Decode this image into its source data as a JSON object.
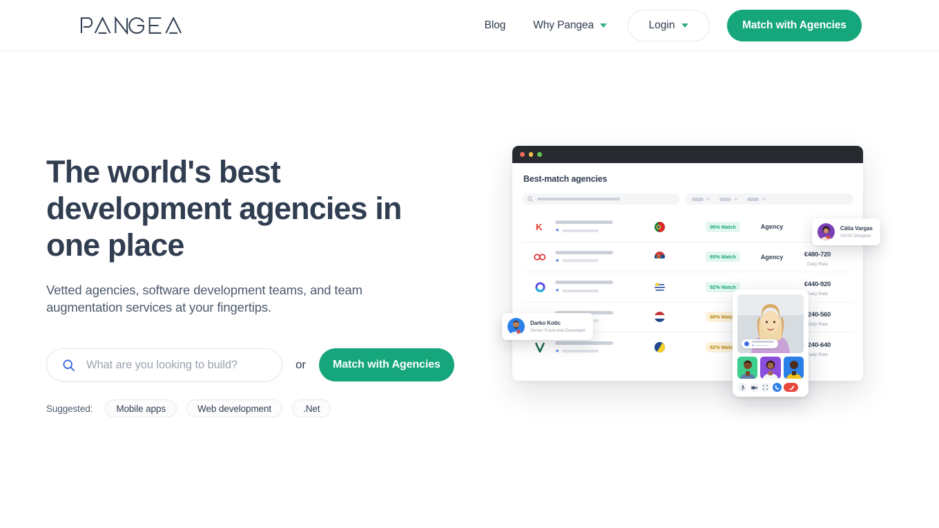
{
  "brand": {
    "name": "PANGEA",
    "accent": "#16a67c",
    "text_color": "#313e51"
  },
  "header": {
    "nav": [
      {
        "label": "Blog",
        "has_caret": false
      },
      {
        "label": "Why Pangea",
        "has_caret": true
      }
    ],
    "login_label": "Login",
    "cta_label": "Match with Agencies"
  },
  "hero": {
    "headline": "The world's best development agencies in one place",
    "subhead": "Vetted agencies, software development teams, and team augmentation services at your fingertips.",
    "search_placeholder": "What are you looking to build?",
    "search_value": "",
    "search_icon": "search-icon",
    "or_label": "or",
    "cta_label": "Match with Agencies",
    "suggested_label": "Suggested:",
    "suggested": [
      "Mobile apps",
      "Web development",
      ".Net"
    ]
  },
  "mock": {
    "title": "Best-match agencies",
    "window_dots": [
      "red",
      "yellow",
      "green"
    ],
    "rows": [
      {
        "logo": "kaizen-k-logo",
        "flag": "portugal-flag",
        "match": "95% Match",
        "match_tone": "green",
        "type": "Agency",
        "rate": "",
        "rate_label": ""
      },
      {
        "logo": "infinity-logo",
        "flag": "serbia-flag",
        "match": "93% Match",
        "match_tone": "green",
        "type": "Agency",
        "rate": "€480-720",
        "rate_label": "Daily Rate"
      },
      {
        "logo": "ring-o-logo",
        "flag": "uruguay-flag",
        "match": "92% Match",
        "match_tone": "green",
        "type": "",
        "rate": "€440-920",
        "rate_label": "Daily Rate"
      },
      {
        "logo": "hidden-logo",
        "flag": "netherlands-flag",
        "match": "88% Match",
        "match_tone": "amber",
        "type": "",
        "rate": "€240-560",
        "rate_label": "Daily Rate"
      },
      {
        "logo": "v-logo",
        "flag": "bosnia-flag",
        "match": "82% Match",
        "match_tone": "amber",
        "type": "",
        "rate": "€240-640",
        "rate_label": "Daily Rate"
      }
    ],
    "cards": [
      {
        "name": "Cátia Vargas",
        "role": "UI/UX Designer"
      },
      {
        "name": "Darko Kotic",
        "role": "Senior Front-end Developer"
      }
    ],
    "call_controls": [
      "mic-icon",
      "camera-icon",
      "share-screen-icon",
      "call-icon",
      "hangup-icon"
    ]
  }
}
